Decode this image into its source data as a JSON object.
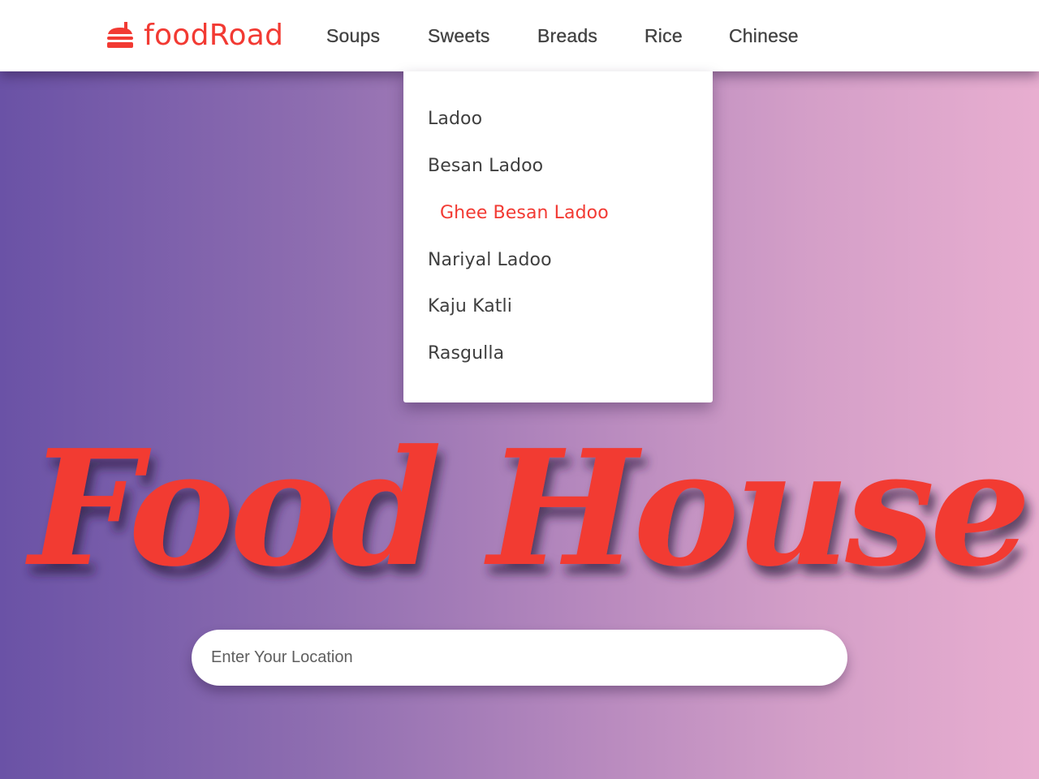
{
  "brand": {
    "name": "foodRoad",
    "icon": "burger-icon",
    "color": "#f23a33"
  },
  "nav": {
    "items": [
      {
        "label": "Soups"
      },
      {
        "label": "Sweets"
      },
      {
        "label": "Breads"
      },
      {
        "label": "Rice"
      },
      {
        "label": "Chinese"
      }
    ]
  },
  "dropdown": {
    "parent": "Sweets",
    "items": [
      {
        "label": "Ladoo",
        "active": false
      },
      {
        "label": "Besan Ladoo",
        "active": false
      },
      {
        "label": "Ghee Besan Ladoo",
        "active": true
      },
      {
        "label": "Nariyal Ladoo",
        "active": false
      },
      {
        "label": "Kaju Katli",
        "active": false
      },
      {
        "label": "Rasgulla",
        "active": false
      }
    ]
  },
  "hero": {
    "title": "Food House",
    "title_color": "#f23a33"
  },
  "search": {
    "placeholder": "Enter Your Location",
    "value": ""
  },
  "colors": {
    "gradient_start": "#6a52a6",
    "gradient_end": "#e8aed0",
    "accent": "#f23a33"
  }
}
